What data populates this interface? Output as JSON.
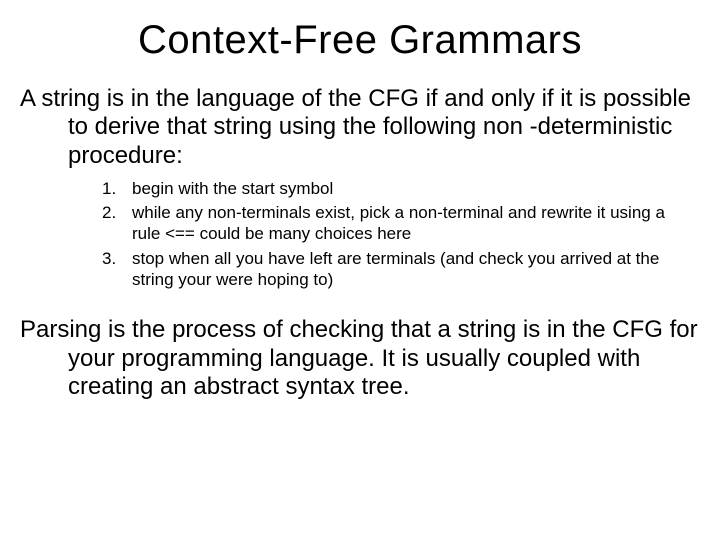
{
  "title": "Context-Free Grammars",
  "para1": "A string is in the language of the CFG if and only if it is possible to derive that string using the following non -deterministic procedure:",
  "list": {
    "n1": "1.",
    "i1": "begin with the start symbol",
    "n2": "2.",
    "i2": "while any non-terminals exist, pick a non-terminal and rewrite it using a rule <== could be many choices here",
    "n3": "3.",
    "i3": "stop when all you have left are terminals (and check you arrived at the string your were hoping to)"
  },
  "para2": "Parsing is the process of checking that a string is in the CFG for your programming language.  It is usually coupled with creating an abstract syntax tree."
}
